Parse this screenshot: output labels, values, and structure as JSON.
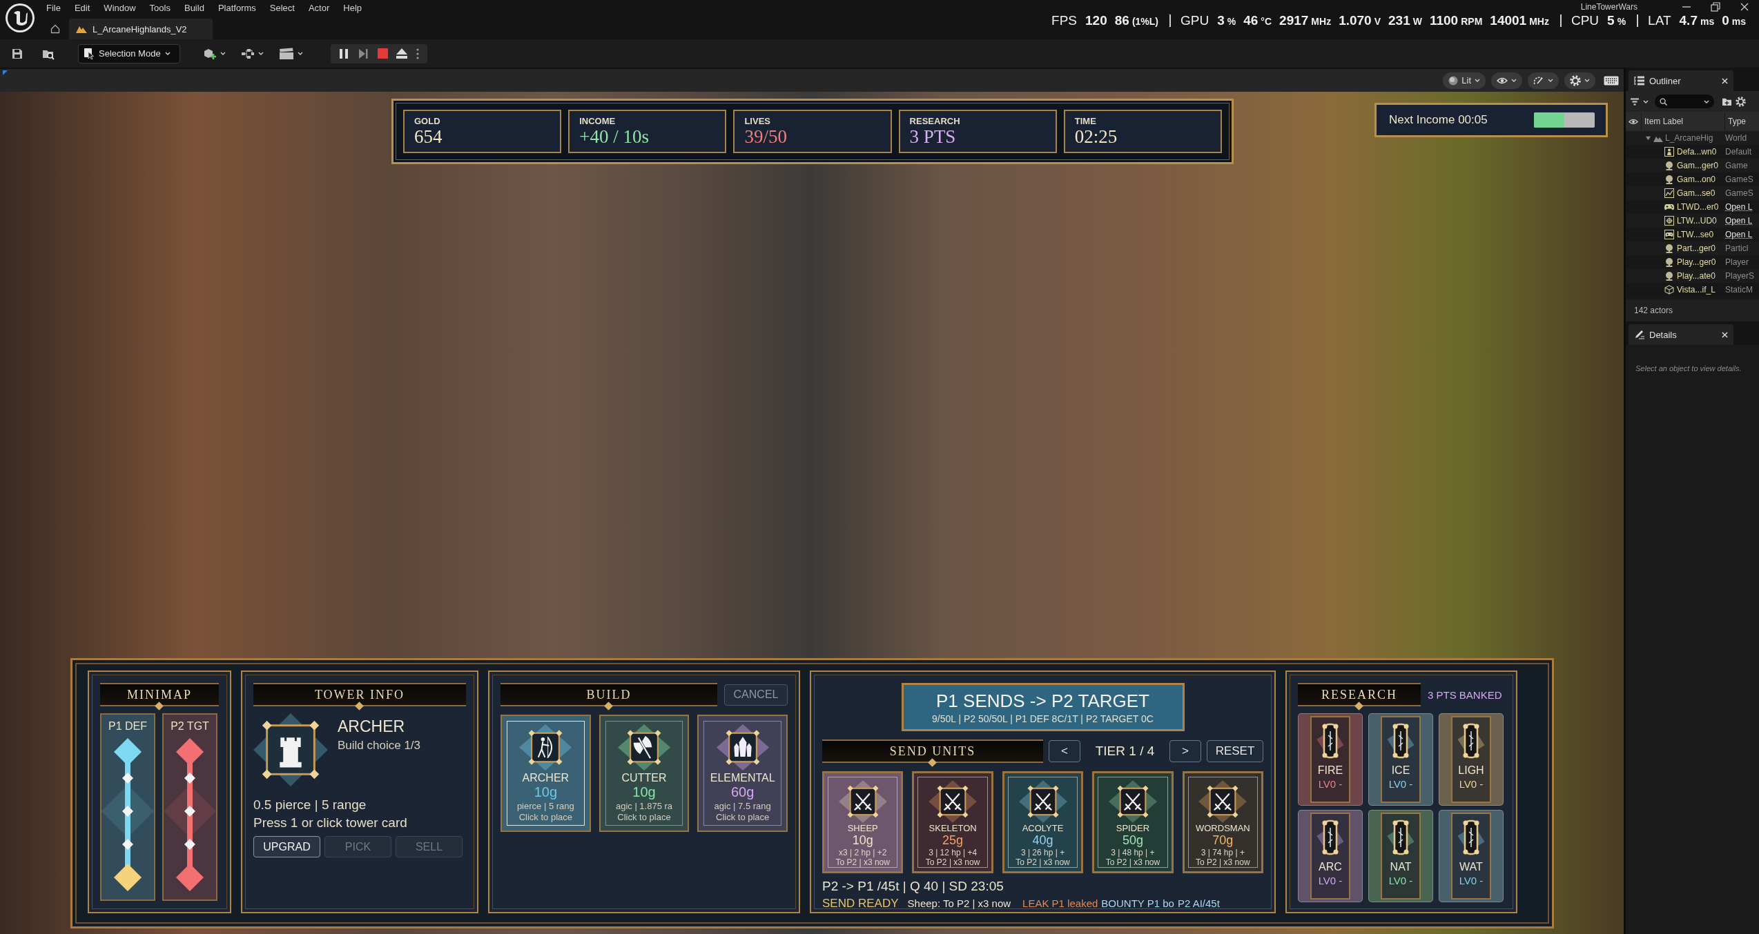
{
  "window": {
    "title": "LineTowerWars"
  },
  "menu": [
    "File",
    "Edit",
    "Window",
    "Tools",
    "Build",
    "Platforms",
    "Select",
    "Actor",
    "Help"
  ],
  "level_tab": {
    "title": "L_ArcaneHighlands_V2"
  },
  "performance_overlay": [
    {
      "label": "FPS",
      "readings": [
        {
          "value": "120"
        },
        {
          "value": "86",
          "unit": "(1%L)"
        }
      ]
    },
    {
      "label": "GPU",
      "readings": [
        {
          "value": "3",
          "unit": "%"
        },
        {
          "value": "46",
          "unit": "°C"
        },
        {
          "value": "2917",
          "unit": "MHz"
        },
        {
          "value": "1.070",
          "unit": "V"
        },
        {
          "value": "231",
          "unit": "W"
        },
        {
          "value": "1100",
          "unit": "RPM"
        },
        {
          "value": "14001",
          "unit": "MHz"
        }
      ]
    },
    {
      "label": "CPU",
      "readings": [
        {
          "value": "5",
          "unit": "%"
        }
      ]
    },
    {
      "label": "LAT",
      "readings": [
        {
          "value": "4.7",
          "unit": "ms"
        },
        {
          "value": "0",
          "unit": "ms"
        }
      ]
    }
  ],
  "toolbar": {
    "mode": "Selection Mode"
  },
  "viewport_toolbar": {
    "view_mode": "Lit"
  },
  "hud": {
    "stats": [
      {
        "label": "GOLD",
        "value": "654",
        "color": "#f3e7c6"
      },
      {
        "label": "INCOME",
        "value": "+40 / 10s",
        "color": "#8ee3a6"
      },
      {
        "label": "LIVES",
        "value": "39/50",
        "color": "#f07f7f"
      },
      {
        "label": "RESEARCH",
        "value": "3 PTS",
        "color": "#d9aef2"
      },
      {
        "label": "TIME",
        "value": "02:25",
        "color": "#f3e7c6"
      }
    ],
    "next_income": {
      "label": "Next Income 00:05",
      "level": 0.5
    }
  },
  "minimap": {
    "title": "MINIMAP",
    "lanes": [
      {
        "label": "P1 DEF",
        "color": "#7fd8f2",
        "end_marker": {
          "color": "#f6d27c"
        }
      },
      {
        "label": "P2 TGT",
        "color": "#f26f72",
        "end_marker": {
          "color": "#f26f72"
        }
      }
    ]
  },
  "tower_info": {
    "title": "TOWER INFO",
    "name": "ARCHER",
    "subtitle": "Build choice 1/3",
    "stats": "0.5 pierce | 5 range",
    "hint": "Press 1 or click tower card",
    "actions": [
      {
        "label": "UPGRAD",
        "disabled": false
      },
      {
        "label": "PICK",
        "disabled": true
      },
      {
        "label": "SELL",
        "disabled": true
      }
    ]
  },
  "build": {
    "title": "BUILD",
    "cancel": "CANCEL",
    "towers": [
      {
        "kind": "archer",
        "name": "ARCHER",
        "cost": "10g",
        "stats": "pierce | 5 rang",
        "hint": "Click to place",
        "color": "#6cc6e6",
        "selected": true
      },
      {
        "kind": "cutter",
        "name": "CUTTER",
        "cost": "10g",
        "stats": "agic | 1.875 ra",
        "hint": "Click to place",
        "color": "#86e3a8",
        "selected": false
      },
      {
        "kind": "elemental",
        "name": "ELEMENTAL",
        "cost": "60g",
        "stats": "agic | 7.5 rang",
        "hint": "Click to place",
        "color": "#d7a8f2",
        "selected": false
      }
    ]
  },
  "send": {
    "banner": {
      "title": "P1 SENDS -> P2 TARGET",
      "details": "9/50L | P2 50/50L | P1 DEF 8C/1T | P2 TARGET 0C"
    },
    "title": "SEND UNITS",
    "prev": "<",
    "tier": "TIER 1 / 4",
    "next": ">",
    "reset": "RESET",
    "units": [
      {
        "name": "SHEEP",
        "price": {
          "text": "10g",
          "color": "#efe3c7"
        },
        "stats": "x3 | 2 hp | +2",
        "target": "To P2 | x3 now",
        "color": "#6e566c"
      },
      {
        "name": "SKELETON",
        "price": {
          "text": "25g",
          "color": "#f2a266"
        },
        "stats": "3 | 12 hp | +4",
        "target": "To P2 | x3 now",
        "color": "#3e2a30"
      },
      {
        "name": "ACOLYTE",
        "price": {
          "text": "40g",
          "color": "#93d3ec"
        },
        "stats": "3 | 26 hp | +",
        "target": "To P2 | x3 now",
        "color": "#24424c"
      },
      {
        "name": "SPIDER",
        "price": {
          "text": "50g",
          "color": "#9fe3b5"
        },
        "stats": "3 | 48 hp | +",
        "target": "To P2 | x3 now",
        "color": "#223c36"
      },
      {
        "name": "WORDSMAN",
        "price": {
          "text": "70g",
          "color": "#f2b468"
        },
        "stats": "3 | 74 hp | +",
        "target": "To P2 | x3 now",
        "color": "#34302c"
      }
    ],
    "status": "P2 -> P1 /45t | Q 40 | SD 23:05",
    "log": [
      {
        "kind": "ready",
        "text": "SEND READY"
      },
      {
        "kind": "info",
        "text": "Sheep: To P2 | x3 now"
      },
      {
        "kind": "leak",
        "text": "LEAK P1 leaked"
      },
      {
        "kind": "bounty",
        "text": "BOUNTY P1 bo"
      },
      {
        "kind": "bounty",
        "text": "P2 AI/45t"
      }
    ]
  },
  "research": {
    "title": "RESEARCH",
    "banked": "3 PTS BANKED",
    "branches": [
      {
        "name": "FIRE",
        "rank": "LV0 -",
        "color": "#f07f86"
      },
      {
        "name": "ICE",
        "rank": "LV0 -",
        "color": "#82d2f0"
      },
      {
        "name": "LIGH",
        "rank": "LV0 -",
        "color": "#f2d595"
      },
      {
        "name": "ARC",
        "rank": "LV0 -",
        "color": "#cfa9f0"
      },
      {
        "name": "NAT",
        "rank": "LV0 -",
        "color": "#86e3a8"
      },
      {
        "name": "WAT",
        "rank": "LV0 -",
        "color": "#82d2f0"
      }
    ]
  },
  "outliner": {
    "title": "Outliner",
    "columns": [
      "Item Label",
      "Type"
    ],
    "rows": [
      {
        "kind": "world",
        "label": "L_ArcaneHig",
        "type": "World",
        "expanded": true,
        "children": [
          {
            "kind": "pawn",
            "label": "Defa...wn0",
            "type": "Default",
            "linked": false
          },
          {
            "kind": "info",
            "label": "Gam...ger0",
            "type": "Game",
            "linked": false
          },
          {
            "kind": "info",
            "label": "Gam...on0",
            "type": "GameS",
            "linked": false
          },
          {
            "kind": "mode",
            "label": "Gam...se0",
            "type": "GameS",
            "linked": false
          },
          {
            "kind": "controller",
            "label": "LTWD...er0",
            "type": "Open L",
            "linked": true
          },
          {
            "kind": "hud",
            "label": "LTW...UD0",
            "type": "Open L",
            "linked": true
          },
          {
            "kind": "gamemode",
            "label": "LTW...se0",
            "type": "Open L",
            "linked": true
          },
          {
            "kind": "info",
            "label": "Part...ger0",
            "type": "Particl",
            "linked": false
          },
          {
            "kind": "info",
            "label": "Play...ger0",
            "type": "Player",
            "linked": false
          },
          {
            "kind": "info",
            "label": "Play...ate0",
            "type": "PlayerS",
            "linked": false
          },
          {
            "kind": "mesh",
            "label": "Vista...if_L",
            "type": "StaticM",
            "linked": false
          }
        ]
      }
    ],
    "count": "142 actors"
  },
  "details": {
    "title": "Details",
    "empty_message": "Select an object to view details."
  }
}
